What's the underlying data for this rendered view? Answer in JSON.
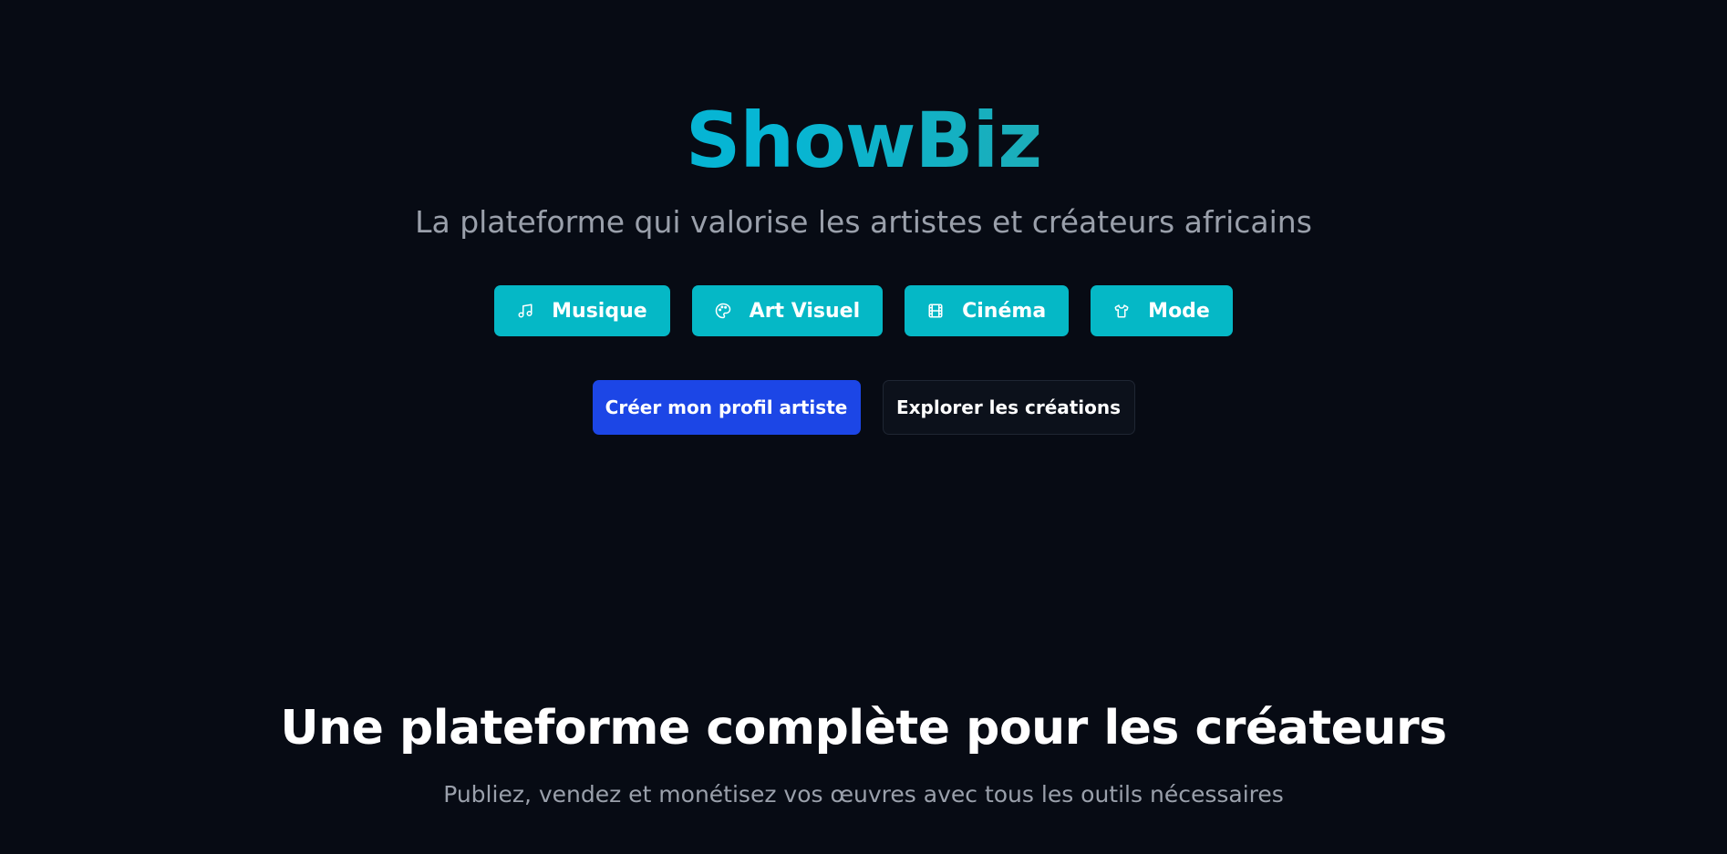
{
  "hero": {
    "brand": "ShowBiz",
    "tagline": "La plateforme qui valorise les artistes et créateurs africains",
    "categories": [
      {
        "label": "Musique",
        "icon": "music-note-icon"
      },
      {
        "label": "Art Visuel",
        "icon": "palette-icon"
      },
      {
        "label": "Cinéma",
        "icon": "film-icon"
      },
      {
        "label": "Mode",
        "icon": "shirt-icon"
      }
    ],
    "cta_primary": "Créer mon profil artiste",
    "cta_secondary": "Explorer les créations"
  },
  "features": {
    "title": "Une plateforme complète pour les créateurs",
    "subtitle": "Publiez, vendez et monétisez vos œuvres avec tous les outils nécessaires"
  },
  "colors": {
    "background": "#070b14",
    "category_button": "#05b8c6",
    "primary_button": "#1c46e6",
    "secondary_button": "#0c111b",
    "brand_gradient_start": "#0aa7cf",
    "brand_gradient_end": "#4db6ac",
    "muted_text": "#9aa0ab"
  }
}
